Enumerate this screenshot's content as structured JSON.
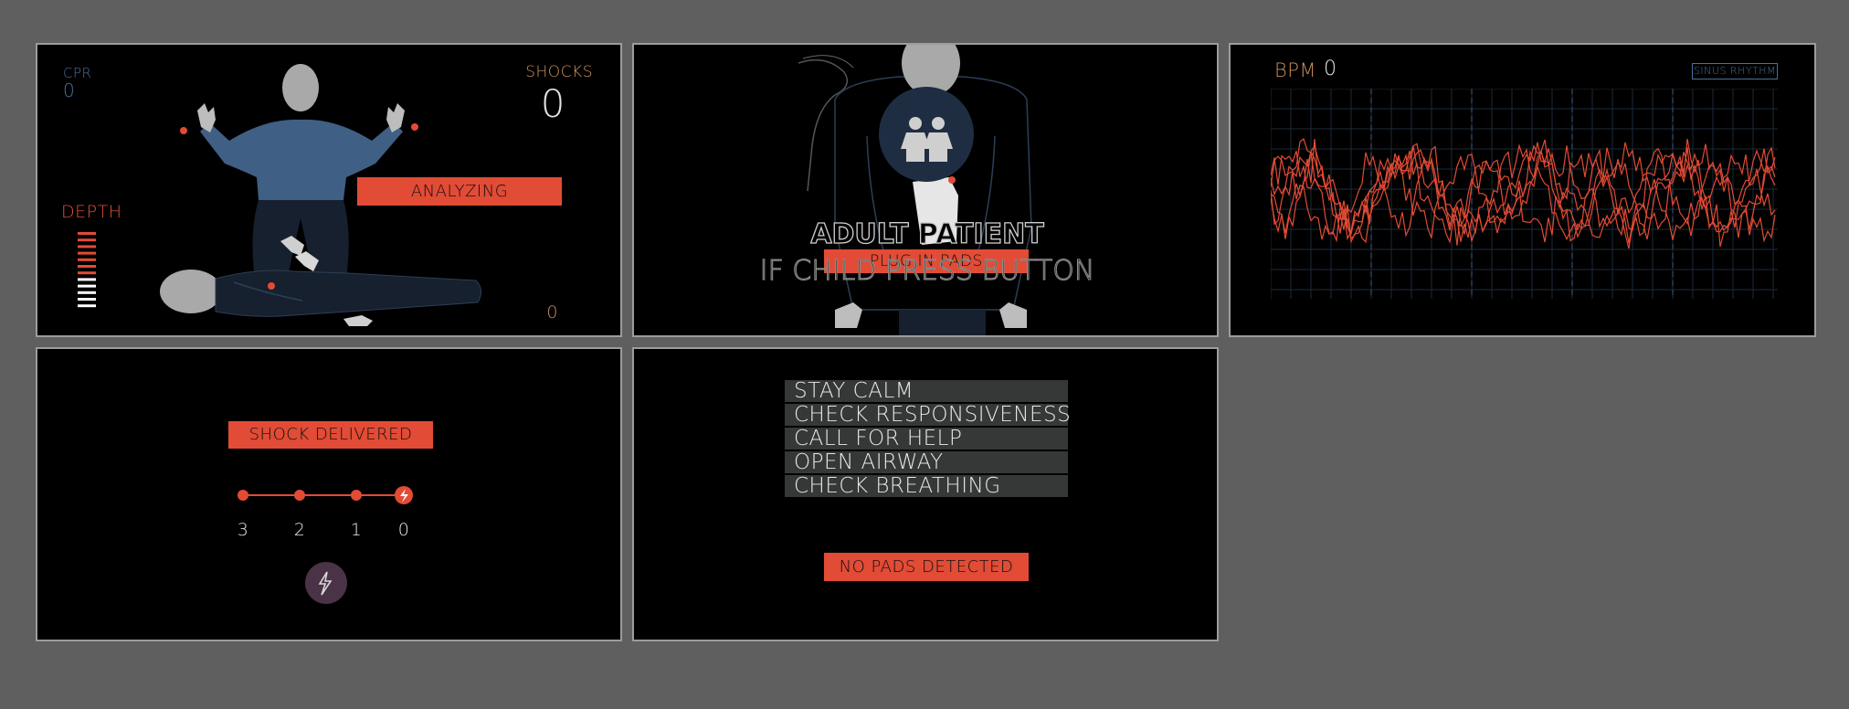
{
  "panel_cpr": {
    "cpr_label": "CPR",
    "cpr_value": "0",
    "shocks_label": "SHOCKS",
    "shocks_value": "0",
    "depth_label": "DEPTH",
    "bottom_value": "0",
    "status": "ANALYZING",
    "depth_levels": {
      "total": 12,
      "red": 7,
      "white": 5
    }
  },
  "panel_patient": {
    "title": "ADULT PATIENT",
    "pads_label": "PLUG IN PADS",
    "note": "IF CHILD PRESS BUTTON",
    "child_button_icon": "children-icon"
  },
  "panel_ecg": {
    "bpm_label": "BPM",
    "bpm_value": "0",
    "rhythm_label": "SINUS RHYTHM"
  },
  "panel_shock": {
    "status": "SHOCK DELIVERED",
    "countdown": [
      "3",
      "2",
      "1",
      "0"
    ],
    "shock_button_icon": "lightning-icon"
  },
  "panel_checklist": {
    "items": [
      "STAY CALM",
      "CHECK RESPONSIVENESS",
      "CALL FOR HELP",
      "OPEN AIRWAY",
      "CHECK BREATHING"
    ],
    "status": "NO PADS DETECTED"
  },
  "colors": {
    "accent_red": "#e24b35",
    "blue": "#4b6f9c",
    "amber": "#c98f5b",
    "panel_bg": "#000000",
    "page_bg": "#5f5f5f"
  }
}
